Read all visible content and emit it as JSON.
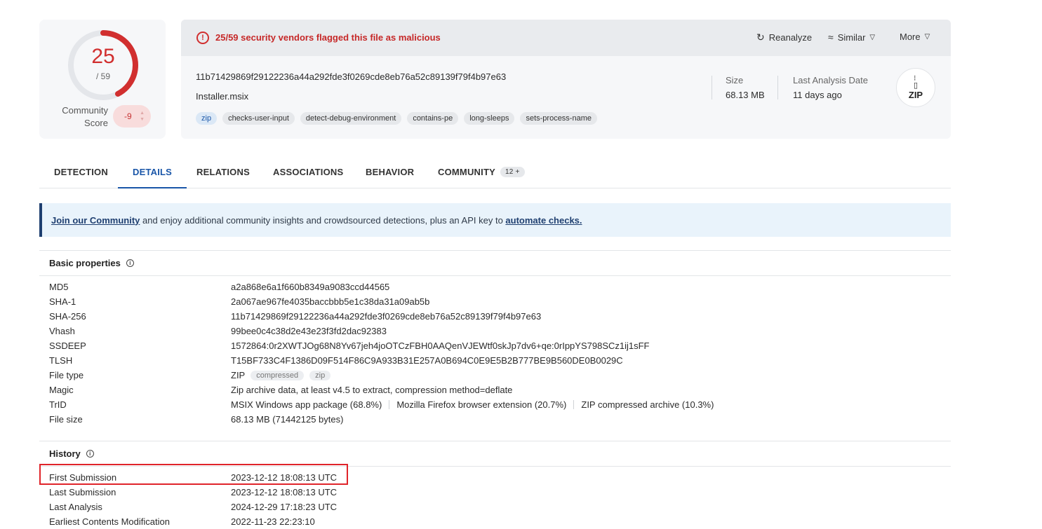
{
  "score": {
    "detections": "25",
    "total": "/ 59",
    "community_label_line1": "Community",
    "community_label_line2": "Score",
    "community_value": "-9"
  },
  "summary": {
    "alert_text": "25/59 security vendors flagged this file as malicious",
    "actions": {
      "reanalyze": "Reanalyze",
      "similar": "Similar",
      "more": "More"
    },
    "hash": "11b71429869f29122236a44a292fde3f0269cde8eb76a52c89139f79f4b97e63",
    "file_name": "Installer.msix",
    "tags": [
      "zip",
      "checks-user-input",
      "detect-debug-environment",
      "contains-pe",
      "long-sleeps",
      "sets-process-name"
    ],
    "size_label": "Size",
    "size_value": "68.13 MB",
    "last_analysis_label": "Last Analysis Date",
    "last_analysis_value": "11 days ago",
    "file_type_badge": "ZIP"
  },
  "tabs": [
    {
      "label": "DETECTION"
    },
    {
      "label": "DETAILS"
    },
    {
      "label": "RELATIONS"
    },
    {
      "label": "ASSOCIATIONS"
    },
    {
      "label": "BEHAVIOR"
    },
    {
      "label": "COMMUNITY",
      "count": "12 +"
    }
  ],
  "banner": {
    "link1": "Join our Community",
    "middle": " and enjoy additional community insights and crowdsourced detections, plus an API key to ",
    "link2": "automate checks."
  },
  "basic_properties": {
    "title": "Basic properties",
    "rows": [
      {
        "key": "MD5",
        "value": "a2a868e6a1f660b8349a9083ccd44565"
      },
      {
        "key": "SHA-1",
        "value": "2a067ae967fe4035baccbbb5e1c38da31a09ab5b"
      },
      {
        "key": "SHA-256",
        "value": "11b71429869f29122236a44a292fde3f0269cde8eb76a52c89139f79f4b97e63"
      },
      {
        "key": "Vhash",
        "value": "99bee0c4c38d2e43e23f3fd2dac92383"
      },
      {
        "key": "SSDEEP",
        "value": "1572864:0r2XWTJOg68N8Yv67jeh4joOTCzFBH0AAQenVJEWtf0skJp7dv6+qe:0rIppYS798SCz1ij1sFF"
      },
      {
        "key": "TLSH",
        "value": "T15BF733C4F1386D09F514F86C9A933B31E257A0B694C0E9E5B2B777BE9B560DE0B0029C"
      },
      {
        "key": "File type",
        "value": "ZIP",
        "tags": [
          "compressed",
          "zip"
        ]
      },
      {
        "key": "Magic",
        "value": "Zip archive data, at least v4.5 to extract, compression method=deflate"
      },
      {
        "key": "TrID",
        "items": [
          "MSIX Windows app package (68.8%)",
          "Mozilla Firefox browser extension (20.7%)",
          "ZIP compressed archive (10.3%)"
        ]
      },
      {
        "key": "File size",
        "value": "68.13 MB (71442125 bytes)"
      }
    ]
  },
  "history": {
    "title": "History",
    "rows": [
      {
        "key": "First Submission",
        "value": "2023-12-12 18:08:13 UTC"
      },
      {
        "key": "Last Submission",
        "value": "2023-12-12 18:08:13 UTC"
      },
      {
        "key": "Last Analysis",
        "value": "2024-12-29 17:18:23 UTC"
      },
      {
        "key": "Earliest Contents Modification",
        "value": "2022-11-23 22:23:10"
      }
    ]
  },
  "colors": {
    "malicious_red": "#d12f2f",
    "accent_blue": "#1a56a8",
    "highlight_red": "#e0242a"
  }
}
